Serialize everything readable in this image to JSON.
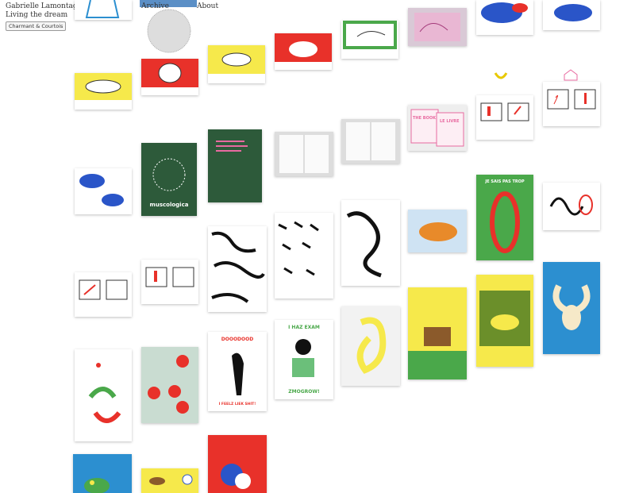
{
  "site": {
    "author": "Gabrielle Lamontagne B",
    "tagline": "Living the dream",
    "tag_button": "Charmant & Courtois"
  },
  "nav": {
    "archive": "Archive",
    "about": "About"
  },
  "posters": {
    "doodood_top": "DOOODOOD",
    "doodood_bottom": "I FEELZ LIEK SHIT!",
    "exam_top": "I HAZ EXAM",
    "exam_bottom": "ZMOGROW!",
    "jesais": "JE SAIS PAS TROP",
    "book_title": "THE BOOK",
    "livre_title": "LE LIVRE",
    "muscologica": "muscologica"
  },
  "colors": {
    "yellow": "#f6e94b",
    "red": "#e8312a",
    "green": "#4aa84a",
    "blue": "#2c8fd0",
    "pink": "#e86aa0"
  }
}
